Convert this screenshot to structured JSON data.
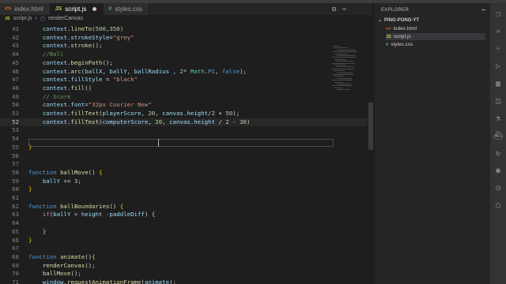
{
  "tabs": [
    {
      "label": "index.html",
      "icon": "html-icon",
      "icon_text": "<>",
      "icon_color": "#e37933",
      "active": false
    },
    {
      "label": "script.js",
      "icon": "js-icon",
      "icon_text": "JS",
      "icon_color": "#cbcb41",
      "active": true,
      "modified": true
    },
    {
      "label": "styles.css",
      "icon": "css-icon",
      "icon_text": "#",
      "icon_color": "#519aba",
      "active": false
    }
  ],
  "breadcrumb": {
    "file": "script.js",
    "symbol": "renderCanvas"
  },
  "editor": {
    "current_line": 52,
    "lines": [
      {
        "n": "41",
        "t": [
          [
            "    ",
            ""
          ],
          [
            "context",
            "v"
          ],
          [
            ".",
            ""
          ],
          [
            "lineTo",
            "f"
          ],
          [
            "(",
            ""
          ],
          [
            "500",
            "n"
          ],
          [
            ",",
            ""
          ],
          [
            "350",
            "n"
          ],
          [
            ")",
            ""
          ]
        ]
      },
      {
        "n": "42",
        "t": [
          [
            "    ",
            ""
          ],
          [
            "context",
            "v"
          ],
          [
            ".",
            ""
          ],
          [
            "strokeStyle",
            "v"
          ],
          [
            "=",
            ""
          ],
          [
            "\"grey\"",
            "s"
          ]
        ]
      },
      {
        "n": "43",
        "t": [
          [
            "    ",
            ""
          ],
          [
            "context",
            "v"
          ],
          [
            ".",
            ""
          ],
          [
            "stroke",
            "f"
          ],
          [
            "();",
            ""
          ]
        ]
      },
      {
        "n": "44",
        "t": [
          [
            "    ",
            ""
          ],
          [
            "//Ball",
            "c"
          ]
        ]
      },
      {
        "n": "45",
        "t": [
          [
            "    ",
            ""
          ],
          [
            "context",
            "v"
          ],
          [
            ".",
            ""
          ],
          [
            "beginPath",
            "f"
          ],
          [
            "();",
            ""
          ]
        ]
      },
      {
        "n": "46",
        "t": [
          [
            "    ",
            ""
          ],
          [
            "context",
            "v"
          ],
          [
            ".",
            ""
          ],
          [
            "arc",
            "f"
          ],
          [
            "(",
            ""
          ],
          [
            "ballX",
            "v"
          ],
          [
            ", ",
            ""
          ],
          [
            "ballY",
            "v"
          ],
          [
            ", ",
            ""
          ],
          [
            "ballRadius",
            "v"
          ],
          [
            " , ",
            ""
          ],
          [
            "2",
            "n"
          ],
          [
            "* ",
            ""
          ],
          [
            "Math",
            "t"
          ],
          [
            ".",
            ""
          ],
          [
            "PI",
            "b"
          ],
          [
            ", ",
            ""
          ],
          [
            "false",
            "b"
          ],
          [
            ");",
            ""
          ]
        ]
      },
      {
        "n": "47",
        "t": [
          [
            "    ",
            ""
          ],
          [
            "context",
            "v"
          ],
          [
            ".",
            ""
          ],
          [
            "fillStyle",
            "v"
          ],
          [
            " = ",
            ""
          ],
          [
            "\"black\"",
            "s"
          ]
        ]
      },
      {
        "n": "48",
        "t": [
          [
            "    ",
            ""
          ],
          [
            "context",
            "v"
          ],
          [
            ".",
            ""
          ],
          [
            "fill",
            "f"
          ],
          [
            "()",
            ""
          ]
        ]
      },
      {
        "n": "49",
        "t": [
          [
            "    ",
            ""
          ],
          [
            "// Score",
            "c"
          ]
        ]
      },
      {
        "n": "50",
        "t": [
          [
            "    ",
            ""
          ],
          [
            "context",
            "v"
          ],
          [
            ".",
            ""
          ],
          [
            "font",
            "v"
          ],
          [
            "=",
            ""
          ],
          [
            "\"32px Courier New\"",
            "s"
          ]
        ]
      },
      {
        "n": "51",
        "t": [
          [
            "    ",
            ""
          ],
          [
            "context",
            "v"
          ],
          [
            ".",
            ""
          ],
          [
            "fillText",
            "f"
          ],
          [
            "(",
            ""
          ],
          [
            "playerScore",
            "v"
          ],
          [
            ", ",
            ""
          ],
          [
            "20",
            "n"
          ],
          [
            ", ",
            ""
          ],
          [
            "canvas",
            "v"
          ],
          [
            ".",
            ""
          ],
          [
            "height",
            "v"
          ],
          [
            "/",
            ""
          ],
          [
            "2",
            "n"
          ],
          [
            " + ",
            ""
          ],
          [
            "50",
            "n"
          ],
          [
            ");",
            ""
          ]
        ]
      },
      {
        "n": "52",
        "t": [
          [
            "    ",
            ""
          ],
          [
            "context",
            "v"
          ],
          [
            ".",
            ""
          ],
          [
            "fillText",
            "f"
          ],
          [
            "(",
            ""
          ],
          [
            "computerScore",
            "v"
          ],
          [
            ", ",
            ""
          ],
          [
            "20",
            "n"
          ],
          [
            ", ",
            ""
          ],
          [
            "canvas",
            "v"
          ],
          [
            ".",
            ""
          ],
          [
            "height",
            "v"
          ],
          [
            " / ",
            ""
          ],
          [
            "2",
            "n"
          ],
          [
            " - ",
            ""
          ],
          [
            "30",
            "n"
          ],
          [
            ")",
            ""
          ]
        ]
      },
      {
        "n": "53",
        "t": []
      },
      {
        "n": "54",
        "t": []
      },
      {
        "n": "55",
        "t": [
          [
            "}",
            "p"
          ]
        ]
      },
      {
        "n": "56",
        "t": []
      },
      {
        "n": "57",
        "t": []
      },
      {
        "n": "58",
        "t": [
          [
            "function",
            "b"
          ],
          [
            " ",
            ""
          ],
          [
            "ballMove",
            "f"
          ],
          [
            "() ",
            ""
          ],
          [
            "{",
            "p"
          ]
        ]
      },
      {
        "n": "59",
        "t": [
          [
            "    ",
            ""
          ],
          [
            "ballY",
            "v"
          ],
          [
            " += ",
            ""
          ],
          [
            "3",
            "n"
          ],
          [
            ";",
            ""
          ]
        ]
      },
      {
        "n": "60",
        "t": [
          [
            "}",
            "p"
          ]
        ]
      },
      {
        "n": "61",
        "t": []
      },
      {
        "n": "62",
        "t": [
          [
            "function",
            "b"
          ],
          [
            " ",
            ""
          ],
          [
            "ballBoundaries",
            "f"
          ],
          [
            "() ",
            ""
          ],
          [
            "{",
            "p"
          ]
        ]
      },
      {
        "n": "63",
        "t": [
          [
            "    ",
            ""
          ],
          [
            "if",
            "k"
          ],
          [
            "(",
            ""
          ],
          [
            "ballY",
            "v"
          ],
          [
            " > ",
            ""
          ],
          [
            "height",
            "v"
          ],
          [
            " -",
            ""
          ],
          [
            "paddleDiff",
            "v"
          ],
          [
            ") {",
            ""
          ]
        ]
      },
      {
        "n": "64",
        "t": []
      },
      {
        "n": "65",
        "t": [
          [
            "    ",
            ""
          ],
          [
            "}",
            ""
          ]
        ]
      },
      {
        "n": "66",
        "t": [
          [
            "}",
            "p"
          ]
        ]
      },
      {
        "n": "67",
        "t": []
      },
      {
        "n": "68",
        "t": [
          [
            "function",
            "b"
          ],
          [
            " ",
            ""
          ],
          [
            "animate",
            "f"
          ],
          [
            "()",
            ""
          ],
          [
            "{",
            "p"
          ]
        ]
      },
      {
        "n": "69",
        "t": [
          [
            "    ",
            ""
          ],
          [
            "renderCanvas",
            "f"
          ],
          [
            "();",
            ""
          ]
        ]
      },
      {
        "n": "70",
        "t": [
          [
            "    ",
            ""
          ],
          [
            "ballMove",
            "f"
          ],
          [
            "();",
            ""
          ]
        ]
      },
      {
        "n": "71",
        "t": [
          [
            "    ",
            ""
          ],
          [
            "window",
            "v"
          ],
          [
            ".",
            ""
          ],
          [
            "requestAnimationFrame",
            "f"
          ],
          [
            "(",
            ""
          ],
          [
            "animate",
            "v"
          ],
          [
            ");",
            ""
          ]
        ]
      }
    ]
  },
  "explorer": {
    "title": "EXPLORER",
    "folder": "PING-PONG-YT",
    "files": [
      {
        "label": "index.html",
        "icon": "html-icon",
        "icon_text": "<>",
        "icon_color": "#e37933",
        "selected": false
      },
      {
        "label": "script.js",
        "icon": "js-icon",
        "icon_text": "JS",
        "icon_color": "#cbcb41",
        "selected": true
      },
      {
        "label": "styles.css",
        "icon": "css-icon",
        "icon_text": "#",
        "icon_color": "#519aba",
        "selected": false
      }
    ]
  },
  "activity_bar": [
    "files-icon",
    "search-icon",
    "source-control-icon",
    "run-debug-icon",
    "extensions-icon",
    "remote-icon",
    "testing-icon",
    "docker-icon",
    "live-share-icon",
    "git-lens-icon",
    "timeline-icon",
    "account-icon"
  ]
}
